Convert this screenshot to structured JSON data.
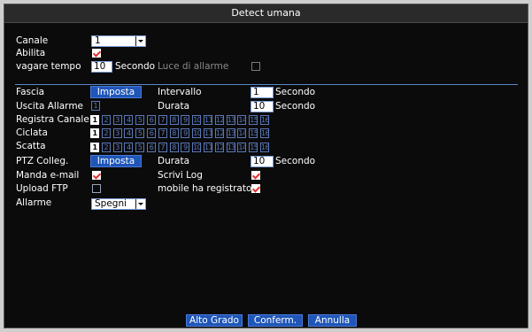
{
  "title": "Detect umana",
  "top": {
    "canale_label": "Canale",
    "canale_value": "1",
    "abilita_label": "Abilita",
    "vagare_label": "vagare tempo",
    "vagare_value": "10",
    "vagare_unit": "Secondo",
    "luce_label": "Luce di allarme"
  },
  "fascia_label": "Fascia",
  "imposta_label": "Imposta",
  "intervallo_label": "Intervallo",
  "intervallo_value": "1",
  "secondo": "Secondo",
  "uscita_label": "Uscita Allarme",
  "uscita_value": "1",
  "durata_label": "Durata",
  "durata1_value": "10",
  "registra_label": "Registra Canale",
  "ciclata_label": "Ciclata",
  "scatta_label": "Scatta",
  "channels": [
    "1",
    "2",
    "3",
    "4",
    "5",
    "6",
    "7",
    "8",
    "9",
    "10",
    "11",
    "12",
    "13",
    "14",
    "15",
    "16"
  ],
  "ptz_label": "PTZ Colleg.",
  "imposta2_label": "Imposta",
  "durata2_label": "Durata",
  "durata2_value": "10",
  "secondo2": "Secondo",
  "email_label": "Manda e-mail",
  "scrivi_label": "Scrivi Log",
  "ftp_label": "Upload FTP",
  "mobile_label": "mobile ha registrato",
  "allarme_label": "Allarme",
  "allarme_value": "Spegni",
  "buttons": {
    "alto": "Alto Grado",
    "conferm": "Conferm.",
    "annulla": "Annulla"
  }
}
